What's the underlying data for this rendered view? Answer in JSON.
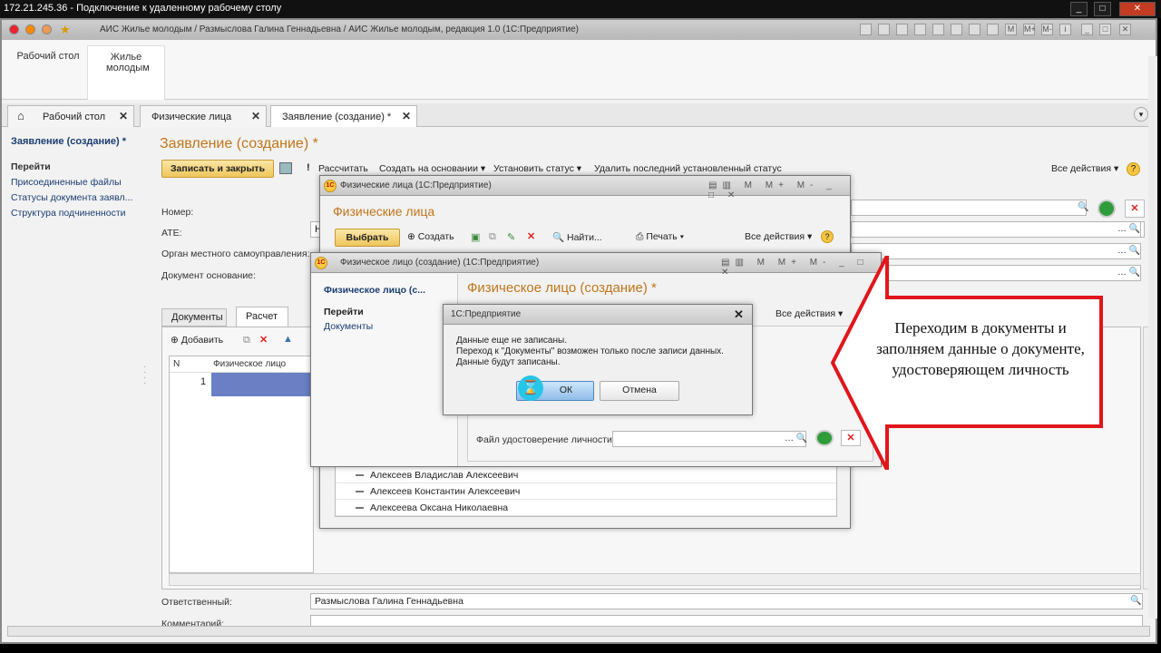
{
  "rdp": {
    "title": "172.21.245.36 - Подключение к удаленному рабочему столу"
  },
  "app": {
    "title": "АИС Жилье молодым / Размыслова Галина Геннадьевна / АИС Жилье молодым, редакция 1.0  (1С:Предприятие)",
    "sections": [
      "Рабочий стол",
      "Жилье молодым"
    ],
    "tabs": [
      "Рабочий стол",
      "Физические лица",
      "Заявление (создание) *"
    ]
  },
  "nav": {
    "current": "Заявление (создание) *",
    "goto": "Перейти",
    "items": [
      "Присоединенные файлы",
      "Статусы документа заявл...",
      "Структура подчиненности"
    ]
  },
  "form": {
    "title": "Заявление (создание) *",
    "save_close": "Записать и закрыть",
    "calc": "Рассчитать",
    "create_based": "Создать на основании",
    "set_status": "Установить статус",
    "delete_status": "Удалить последний установленный статус",
    "all_actions": "Все действия",
    "labels": {
      "number": "Номер:",
      "ate": "АТЕ:",
      "organ": "Орган местного самоуправления:",
      "doc_base": "Документ основание:"
    },
    "ate_value": "Н",
    "inner_tabs": [
      "Документы",
      "Расчет"
    ],
    "add": "Добавить",
    "grid_cols": [
      "N",
      "Физическое лицо"
    ],
    "grid_row_n": "1",
    "responsible_label": "Ответственный:",
    "responsible_value": "Размыслова Галина Геннадьевна",
    "comment_label": "Комментарий:"
  },
  "persons_window": {
    "title": "Физические лица  (1С:Предприятие)",
    "heading": "Физические лица",
    "select": "Выбрать",
    "create": "Создать",
    "find": "Найти...",
    "print": "Печать",
    "all_actions": "Все действия",
    "list": [
      "Алексеев Владислав Алексеевич",
      "Алексеев Константин Алексеевич",
      "Алексеева Оксана Николаевна"
    ]
  },
  "person_create_window": {
    "title": "Физическое лицо (создание)  (1С:Предприятие)",
    "nav_current": "Физическое лицо (с...",
    "goto": "Перейти",
    "nav_item": "Документы",
    "heading": "Физическое лицо (создание) *",
    "all_actions": "Все действия",
    "file_label": "Файл удостоверение личности:"
  },
  "dialog": {
    "title": "1С:Предприятие",
    "line1": "Данные еще не записаны.",
    "line2": "Переход к \"Документы\" возможен только после записи данных.",
    "line3": "Данные будут записаны.",
    "ok": "ОК",
    "cancel": "Отмена"
  },
  "callout": {
    "text": "Переходим в документы и заполняем данные о документе, удостоверяющем личность",
    "color": "#e0161b"
  }
}
